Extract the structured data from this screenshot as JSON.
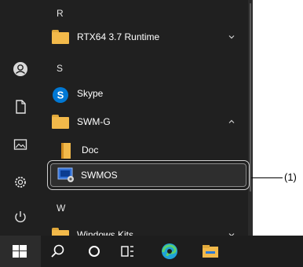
{
  "start_menu": {
    "sections": [
      {
        "letter": "R",
        "apps": [
          {
            "label": "RTX64 3.7 Runtime",
            "icon": "folder-icon",
            "expandable": true
          }
        ]
      },
      {
        "letter": "S",
        "apps": [
          {
            "label": "Skype",
            "icon": "skype-icon"
          },
          {
            "label": "SWM-G",
            "icon": "folder-icon",
            "expanded": true
          },
          {
            "label": "Doc",
            "icon": "folder-icon",
            "child": true
          },
          {
            "label": "SWMOS",
            "icon": "swmos-app-icon",
            "child": true,
            "highlighted": true
          }
        ]
      },
      {
        "letter": "W",
        "apps": [
          {
            "label": "Windows Kits",
            "icon": "folder-icon",
            "expandable": true
          }
        ]
      }
    ],
    "rail_icons": [
      "user-avatar-icon",
      "document-icon",
      "pictures-icon",
      "settings-icon",
      "power-icon"
    ]
  },
  "taskbar": {
    "icons": [
      "windows-start-icon",
      "search-icon",
      "cortana-icon",
      "task-view-icon",
      "edge-icon",
      "file-explorer-icon"
    ]
  },
  "annotation": {
    "label": "(1)"
  },
  "colors": {
    "menu_bg": "#202020",
    "folder": "#f2b94a",
    "skype": "#0078d4",
    "highlight_border": "#cfcfcf"
  }
}
